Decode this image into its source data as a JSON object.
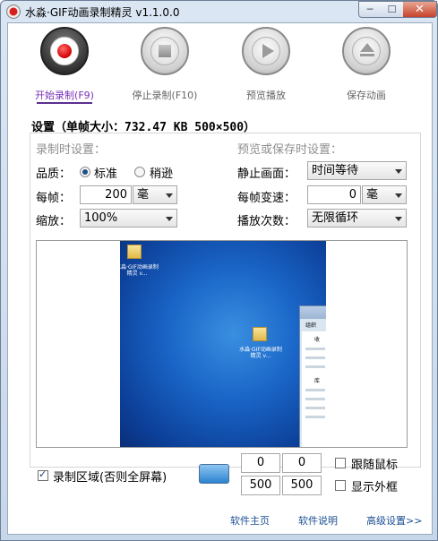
{
  "window": {
    "title": "水淼·GIF动画录制精灵 v1.1.0.0"
  },
  "toolbar": {
    "record_label": "开始录制(F9)",
    "stop_label": "停止录制(F10)",
    "preview_label": "预览播放",
    "save_label": "保存动画"
  },
  "settings": {
    "header": "设置（单帧大小：732.47 KB 500×500）",
    "record": {
      "section_title": "录制时设置：",
      "quality_label": "品质：",
      "quality_options": [
        "标准",
        "稍逊"
      ],
      "quality_selected": "标准",
      "interval_label": "每帧：",
      "interval_value": "200",
      "interval_unit": "毫",
      "zoom_label": "缩放：",
      "zoom_value": "100%"
    },
    "playback": {
      "section_title": "预览或保存时设置：",
      "still_label": "静止画面：",
      "still_value": "时间等待",
      "speed_label": "每帧变速：",
      "speed_value": "0",
      "speed_unit": "毫",
      "loop_label": "播放次数：",
      "loop_value": "无限循环"
    }
  },
  "preview": {
    "desktop_icons": [
      {
        "caption": "水淼·GIF动画录制精灵 v..."
      },
      {
        "caption": "水淼·GIF动画录制精灵 v..."
      }
    ],
    "explorer_labels": [
      "组织",
      "收",
      "库"
    ]
  },
  "region": {
    "checkbox_label": "录制区域(否则全屏幕)",
    "checked": true,
    "x": "0",
    "y": "0",
    "width": "500",
    "height": "500",
    "follow_mouse_label": "跟随鼠标",
    "follow_mouse_checked": false,
    "show_frame_label": "显示外框",
    "show_frame_checked": false
  },
  "footer": {
    "home_link": "软件主页",
    "help_link": "软件说明",
    "advanced_link": "高级设置>>"
  },
  "colors": {
    "record_accent": "#7a2fb8",
    "link": "#1c4e94",
    "desktop_blue": "#1a66c8"
  }
}
